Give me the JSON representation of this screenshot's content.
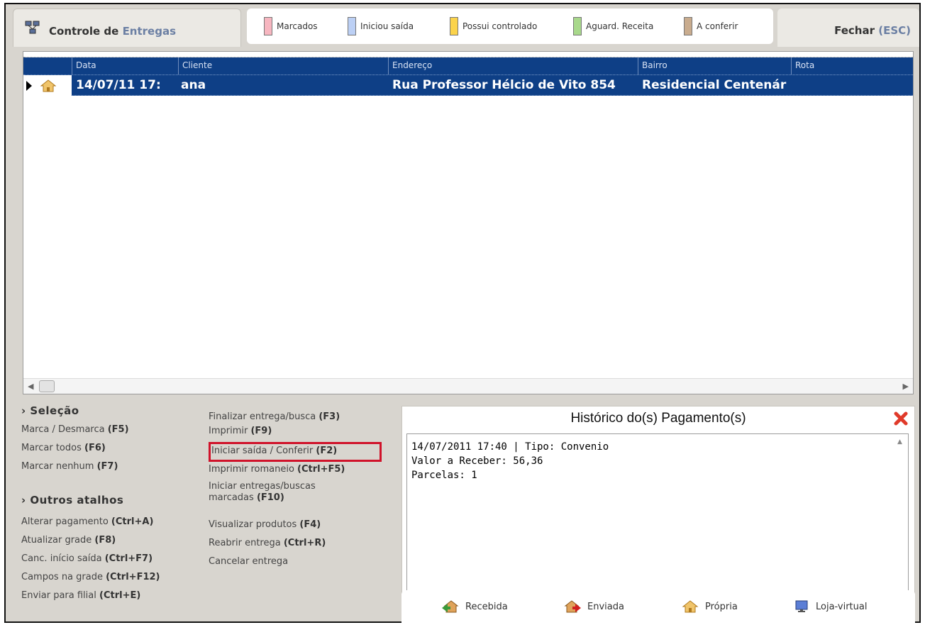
{
  "header": {
    "title_bold": "Controle de",
    "title_light": "Entregas",
    "close_label": "Fechar",
    "close_key": "(ESC)"
  },
  "legend": [
    {
      "label": "Marcados",
      "color": "#f7b6c0"
    },
    {
      "label": "Iniciou saída",
      "color": "#bcd0f5"
    },
    {
      "label": "Possui controlado",
      "color": "#fbd34b"
    },
    {
      "label": "Aguard. Receita",
      "color": "#a8d88b"
    },
    {
      "label": "A conferir",
      "color": "#c9ac8e"
    }
  ],
  "grid": {
    "columns": [
      "Data",
      "Cliente",
      "Endereço",
      "Bairro",
      "Rota"
    ],
    "rows": [
      {
        "data": "14/07/11 17:",
        "cliente": "ana",
        "endereco": "Rua Professor Hélcio de Vito 854",
        "bairro": "Residencial Centenár",
        "rota": ""
      }
    ]
  },
  "selecao": {
    "title": "› Seleção",
    "items": [
      {
        "text": "Marca / Desmarca",
        "key": "(F5)"
      },
      {
        "text": "Marcar todos",
        "key": "(F6)"
      },
      {
        "text": "Marcar nenhum",
        "key": "(F7)"
      }
    ]
  },
  "acoes": {
    "items": [
      {
        "text": "Finalizar entrega/busca",
        "key": "(F3)"
      },
      {
        "text": "Imprimir",
        "key": "(F9)"
      },
      {
        "text": "Iniciar saída / Conferir",
        "key": "(F2)"
      },
      {
        "text": "Imprimir romaneio",
        "key": "(Ctrl+F5)"
      },
      {
        "text": "Iniciar entregas/buscas",
        "key": ""
      },
      {
        "text": "marcadas",
        "key": "(F10)"
      },
      {
        "text": "Visualizar produtos",
        "key": "(F4)"
      },
      {
        "text": "Reabrir entrega",
        "key": "(Ctrl+R)"
      },
      {
        "text": "Cancelar entrega",
        "key": ""
      }
    ]
  },
  "outros": {
    "title": "› Outros atalhos",
    "items": [
      {
        "text": "Alterar pagamento",
        "key": "(Ctrl+A)"
      },
      {
        "text": "Atualizar grade",
        "key": "(F8)"
      },
      {
        "text": "Canc. início saída",
        "key": "(Ctrl+F7)"
      },
      {
        "text": "Campos na grade",
        "key": "(Ctrl+F12)"
      },
      {
        "text": "Enviar para filial",
        "key": "(Ctrl+E)"
      }
    ]
  },
  "historico": {
    "title": "Histórico do(s) Pagamento(s)",
    "lines": [
      "14/07/2011 17:40 | Tipo: Convenio",
      "Valor a Receber: 56,36",
      "Parcelas: 1"
    ]
  },
  "tabs": [
    "Recebida",
    "Enviada",
    "Própria",
    "Loja-virtual"
  ]
}
